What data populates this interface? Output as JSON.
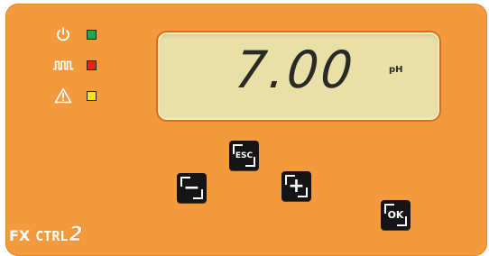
{
  "status_indicators": [
    {
      "icon": "power-icon",
      "led_color": "#1fa84a"
    },
    {
      "icon": "pulse-icon",
      "led_color": "#e2231a"
    },
    {
      "icon": "warning-icon",
      "led_color": "#f6e21c"
    }
  ],
  "display": {
    "value": "7.00",
    "unit": "pH"
  },
  "keys": {
    "esc_label": "ESC",
    "minus_label": "−",
    "plus_label": "+",
    "ok_label": "OK"
  },
  "brand": {
    "fx": "FX",
    "ctrl": "CTRL",
    "version": "2"
  },
  "colors": {
    "panel": "#f39a3f",
    "lcd_background": "#e9e0a8",
    "key_background": "#151515"
  }
}
